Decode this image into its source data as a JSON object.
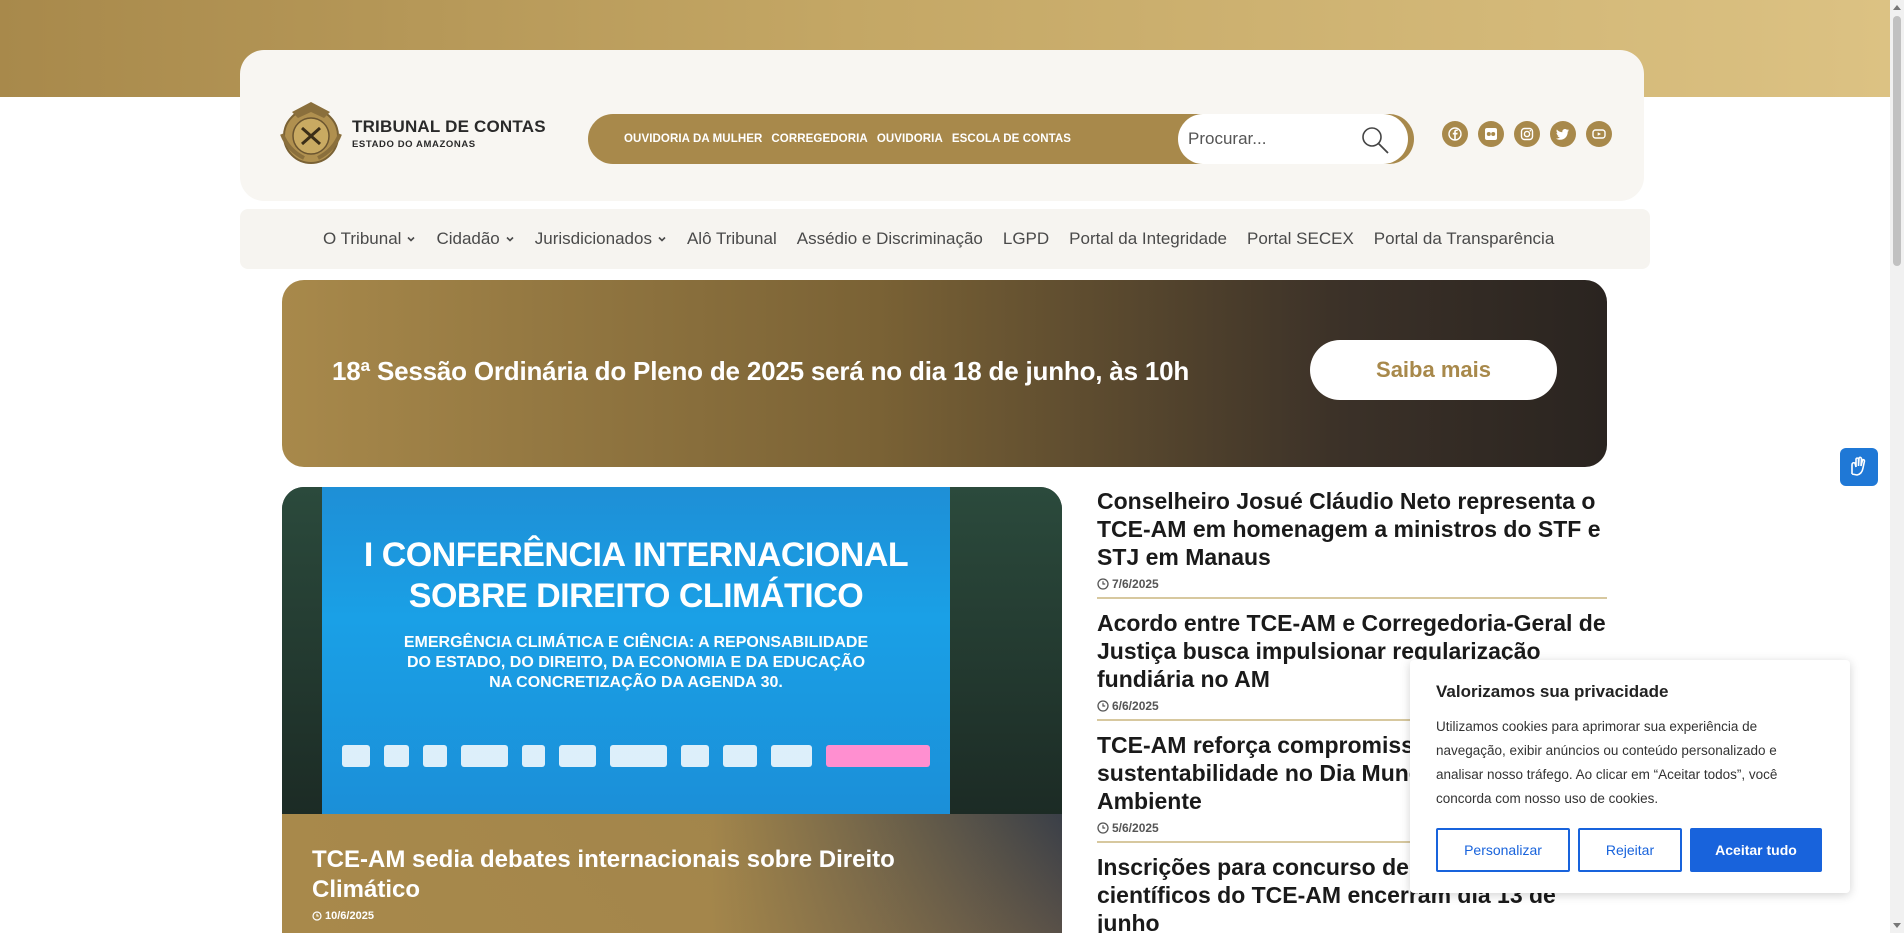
{
  "header": {
    "logo_title": "TRIBUNAL DE CONTAS",
    "logo_subtitle": "ESTADO DO AMAZONAS",
    "quick_links": [
      "OUVIDORIA DA MULHER",
      "CORREGEDORIA",
      "OUVIDORIA",
      "ESCOLA DE CONTAS"
    ],
    "search_placeholder": "Procurar...",
    "socials": [
      "facebook-icon",
      "flickr-icon",
      "instagram-icon",
      "twitter-icon",
      "youtube-icon"
    ]
  },
  "nav": {
    "items": [
      {
        "label": "O Tribunal",
        "dropdown": true
      },
      {
        "label": "Cidadão",
        "dropdown": true
      },
      {
        "label": "Jurisdicionados",
        "dropdown": true
      },
      {
        "label": "Alô Tribunal",
        "dropdown": false
      },
      {
        "label": "Assédio e Discriminação",
        "dropdown": false
      },
      {
        "label": "LGPD",
        "dropdown": false
      },
      {
        "label": "Portal da Integridade",
        "dropdown": false
      },
      {
        "label": "Portal SECEX",
        "dropdown": false
      },
      {
        "label": "Portal da Transparência",
        "dropdown": false
      }
    ]
  },
  "banner": {
    "text": "18ª Sessão Ordinária do Pleno de 2025 será no dia 18 de junho, às 10h",
    "button": "Saiba mais"
  },
  "feature": {
    "screen_title_1": "I CONFERÊNCIA INTERNACIONAL",
    "screen_title_2": "SOBRE DIREITO CLIMÁTICO",
    "screen_sub_1": "EMERGÊNCIA CLIMÁTICA E CIÊNCIA: A REPONSABILIDADE",
    "screen_sub_2": "DO ESTADO, DO DIREITO, DA ECONOMIA E DA EDUCAÇÃO",
    "screen_sub_3": "NA CONCRETIZAÇÃO DA AGENDA 30.",
    "title": "TCE-AM sedia debates internacionais sobre Direito Climático",
    "date": "10/6/2025"
  },
  "news": [
    {
      "title": "Conselheiro Josué Cláudio Neto representa o TCE-AM em homenagem a ministros do STF e STJ em Manaus",
      "date": "7/6/2025"
    },
    {
      "title": "Acordo entre TCE-AM e Corregedoria-Geral de Justiça busca impulsionar regularização fundiária no AM",
      "date": "6/6/2025"
    },
    {
      "title": "TCE-AM reforça compromisso com a sustentabilidade no Dia Mundial do Meio Ambiente",
      "date": "5/6/2025"
    },
    {
      "title": "Inscrições para concurso de artigos científicos do TCE-AM encerram dia 13 de junho",
      "date": ""
    }
  ],
  "cookie": {
    "title": "Valorizamos sua privacidade",
    "text": "Utilizamos cookies para aprimorar sua experiência de navegação, exibir anúncios ou conteúdo personalizado e analisar nosso tráfego. Ao clicar em “Aceitar todos”, você concorda com nosso uso de cookies.",
    "customize": "Personalizar",
    "reject": "Rejeitar",
    "accept": "Aceitar tudo"
  },
  "colors": {
    "gold": "#a8894b",
    "blue": "#1863dc"
  }
}
